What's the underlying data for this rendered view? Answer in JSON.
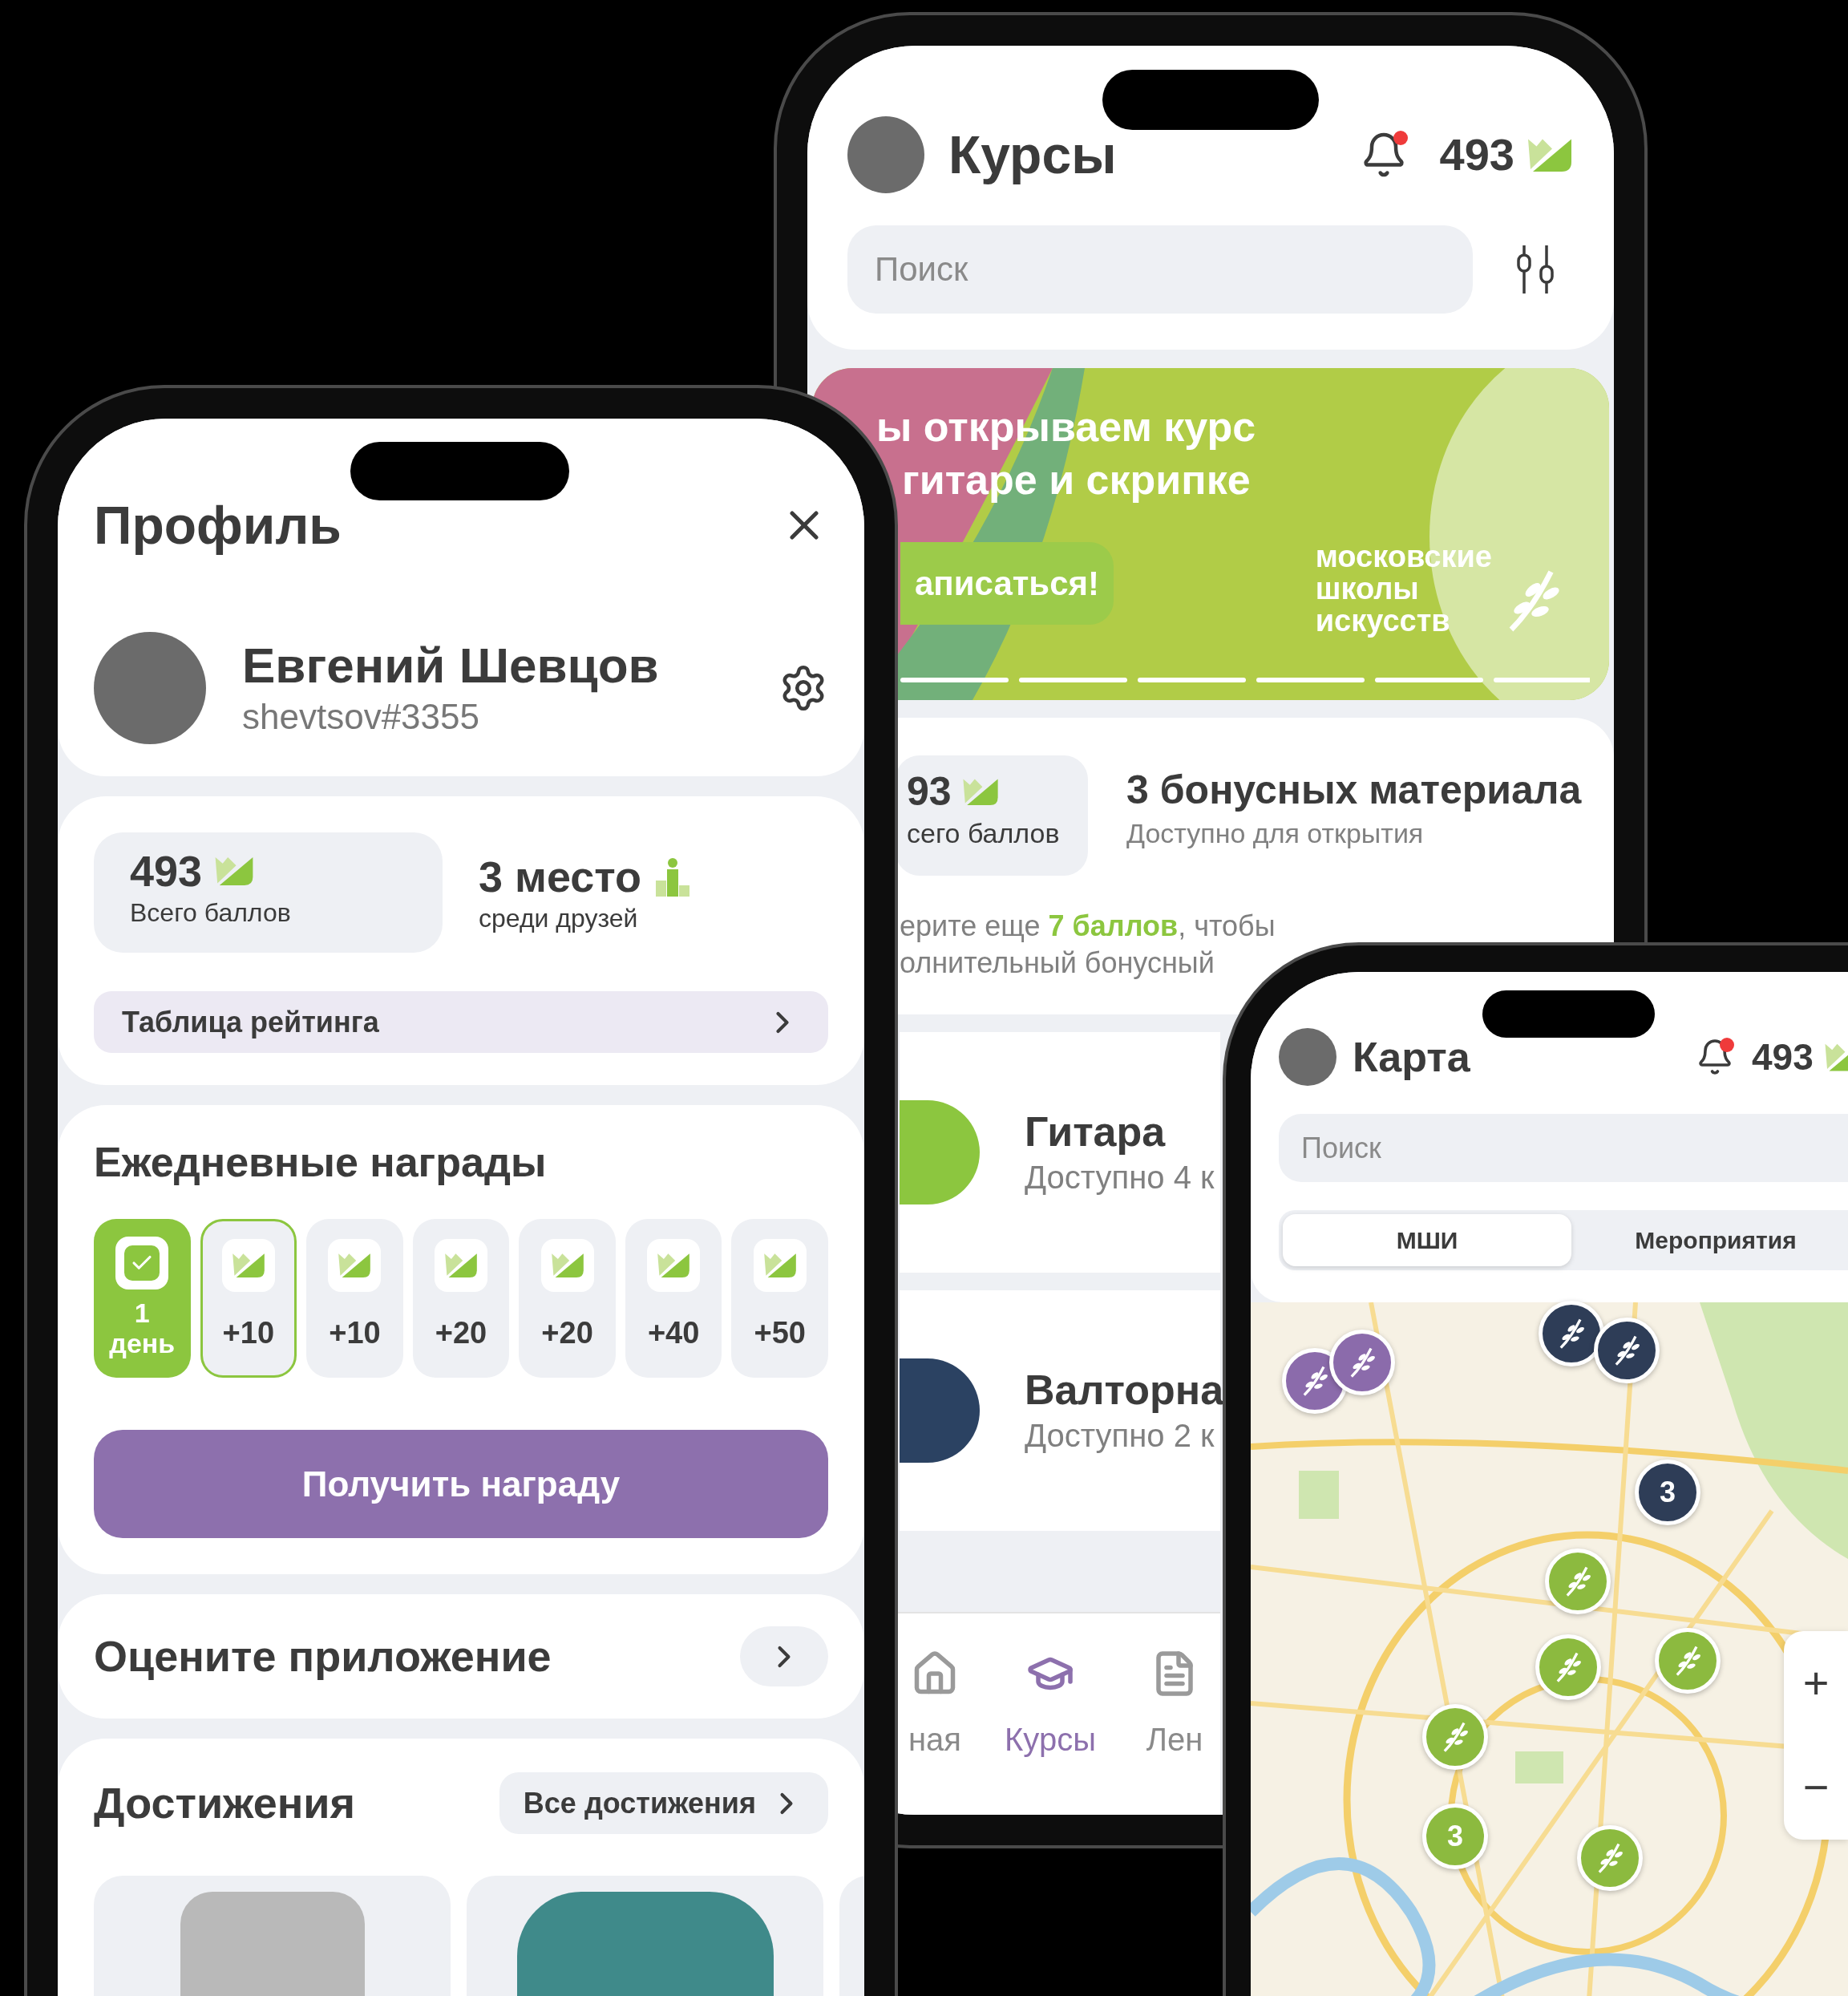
{
  "profile_screen": {
    "title": "Профиль",
    "user": {
      "name": "Евгений Шевцов",
      "username": "shevtsov#3355"
    },
    "stats": {
      "points": "493",
      "points_label": "Всего баллов",
      "rank": "3 место",
      "rank_label": "среди друзей"
    },
    "rating_link": "Таблица рейтинга",
    "daily_rewards": {
      "title": "Ежедневные награды",
      "days": [
        {
          "kind": "claimed",
          "label": "1 день",
          "selected": false
        },
        {
          "kind": "reward",
          "label": "+10",
          "selected": true
        },
        {
          "kind": "reward",
          "label": "+10",
          "selected": false
        },
        {
          "kind": "reward",
          "label": "+20",
          "selected": false
        },
        {
          "kind": "reward",
          "label": "+20",
          "selected": false
        },
        {
          "kind": "reward",
          "label": "+40",
          "selected": false
        },
        {
          "kind": "reward",
          "label": "+50",
          "selected": false
        }
      ],
      "button": "Получить награду"
    },
    "rate_app": "Оцените приложение",
    "achievements": {
      "title": "Достижения",
      "all_link": "Все достижения"
    }
  },
  "courses_screen": {
    "title": "Курсы",
    "has_notifications": true,
    "points": "493",
    "search": {
      "placeholder": "Поиск"
    },
    "banner": {
      "title_lines": [
        "ы открываем курс",
        "гитаре и скрипке"
      ],
      "button": "аписаться!",
      "logo_lines": [
        "московские",
        "школы",
        "искусств"
      ]
    },
    "bonus": {
      "points": "93",
      "points_label": "сего баллов",
      "title": "3 бонусных материала",
      "subtitle": "Доступно для открытия",
      "note_lines": [
        "ерите еще **7 баллов**, чтобы",
        "олнительный бонусный"
      ]
    },
    "courses": [
      {
        "title": "Гитара",
        "subtitle": "Доступно 4 к",
        "color": "#8cc63f"
      },
      {
        "title": "Валторна",
        "subtitle": "Доступно 2 к",
        "color": "#2b4262"
      }
    ],
    "nav": [
      {
        "label": "ная",
        "selected": false
      },
      {
        "label": "Курсы",
        "selected": true
      },
      {
        "label": "Лен",
        "selected": false
      }
    ]
  },
  "map_screen": {
    "title": "Карта",
    "has_notifications": true,
    "points": "493",
    "search": {
      "placeholder": "Поиск"
    },
    "tabs": [
      {
        "label": "МШИ",
        "selected": true
      },
      {
        "label": "Мероприятия",
        "selected": false
      }
    ],
    "markers": [
      {
        "kind": "school",
        "color": "#8b6bab"
      },
      {
        "kind": "school",
        "color": "#8b6bab"
      },
      {
        "kind": "school",
        "color": "#2e3d57"
      },
      {
        "kind": "school",
        "color": "#2e3d57"
      },
      {
        "kind": "cluster",
        "color": "#2e3d57",
        "label": "3"
      },
      {
        "kind": "school",
        "color": "#8cba3f"
      },
      {
        "kind": "school",
        "color": "#8cba3f"
      },
      {
        "kind": "school",
        "color": "#8cba3f"
      },
      {
        "kind": "school",
        "color": "#8cba3f"
      },
      {
        "kind": "cluster",
        "color": "#8cba3f",
        "label": "3"
      },
      {
        "kind": "school",
        "color": "#8cba3f"
      }
    ],
    "zoom": [
      "+",
      "−"
    ]
  }
}
